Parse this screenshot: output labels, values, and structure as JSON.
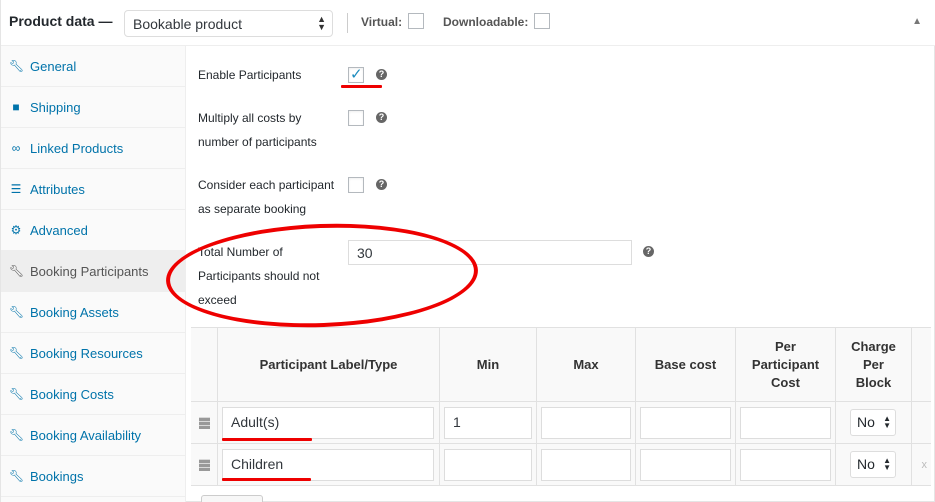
{
  "header": {
    "title": "Product data —",
    "product_type": "Bookable product",
    "virtual_label": "Virtual:",
    "downloadable_label": "Downloadable:"
  },
  "sidebar": {
    "items": [
      {
        "label": "General",
        "icon": "wrench-icon"
      },
      {
        "label": "Shipping",
        "icon": "truck-icon"
      },
      {
        "label": "Linked Products",
        "icon": "link-icon"
      },
      {
        "label": "Attributes",
        "icon": "list-icon"
      },
      {
        "label": "Advanced",
        "icon": "gear-icon"
      },
      {
        "label": "Booking Participants",
        "icon": "wrench-icon",
        "active": true
      },
      {
        "label": "Booking Assets",
        "icon": "wrench-icon"
      },
      {
        "label": "Booking Resources",
        "icon": "wrench-icon"
      },
      {
        "label": "Booking Costs",
        "icon": "wrench-icon"
      },
      {
        "label": "Booking Availability",
        "icon": "wrench-icon"
      },
      {
        "label": "Bookings",
        "icon": "wrench-icon"
      }
    ]
  },
  "options": {
    "enable_participants": {
      "label": "Enable Participants",
      "checked": true
    },
    "multiply_costs": {
      "line1": "Multiply all costs by",
      "line2": "number of participants",
      "checked": false
    },
    "separate_booking": {
      "line1": "Consider each participant",
      "line2": "as separate booking",
      "checked": false
    },
    "total_participants": {
      "line1": "Total Number of",
      "line2": "Participants should not",
      "line3": "exceed",
      "value": "30"
    }
  },
  "table": {
    "headers": {
      "label_type": "Participant Label/Type",
      "min": "Min",
      "max": "Max",
      "base_cost": "Base cost",
      "per_participant_1": "Per",
      "per_participant_2": "Participant",
      "per_participant_3": "Cost",
      "charge_1": "Charge",
      "charge_2": "Per",
      "charge_3": "Block"
    },
    "rows": [
      {
        "label": "Adult(s)",
        "min": "1",
        "max": "",
        "base_cost": "",
        "per_cost": "",
        "charge": "No"
      },
      {
        "label": "Children",
        "min": "",
        "max": "",
        "base_cost": "",
        "per_cost": "",
        "charge": "No",
        "remove": "x"
      }
    ]
  },
  "colors": {
    "link": "#0073aa",
    "annotation_red": "#e00000"
  }
}
